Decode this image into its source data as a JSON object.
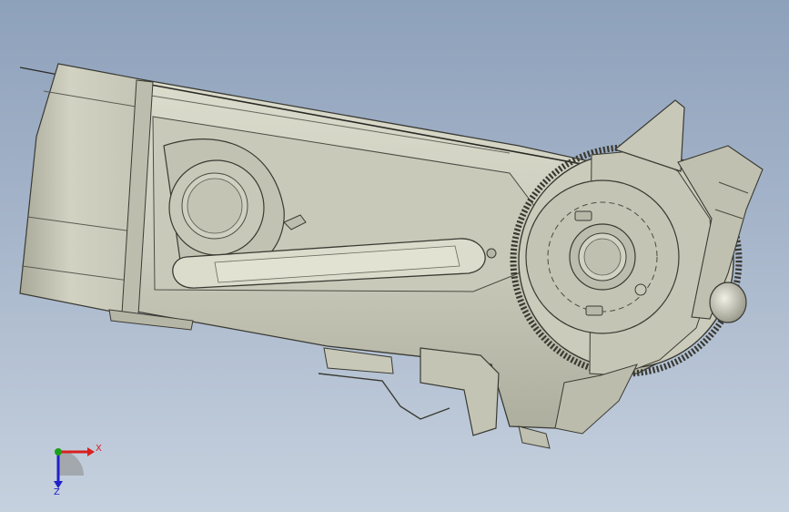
{
  "viewport": {
    "background_top": "#8ea1bb",
    "background_bottom": "#c6d1de",
    "model_fill": "#cfcfbf",
    "model_edge": "#3a3a33",
    "highlight_fill": "#d6d6c6"
  },
  "triad": {
    "x_label": "X",
    "z_label": "Z",
    "x_color": "#d82020",
    "y_color": "#1aa01a",
    "z_color": "#2020c8"
  }
}
